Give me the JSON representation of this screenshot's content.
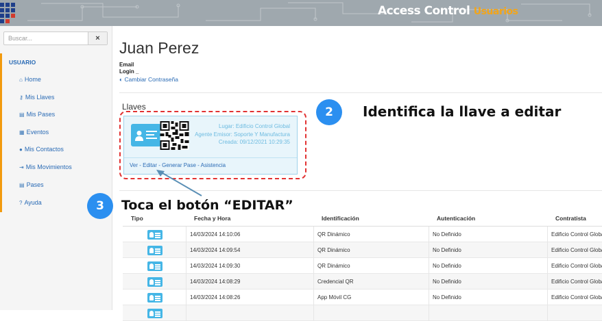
{
  "header": {
    "brand_main": "Access Control",
    "brand_sub": "Usuarios"
  },
  "sidebar": {
    "search_placeholder": "Buscar...",
    "clear_label": "×",
    "section": "USUARIO",
    "items": [
      {
        "icon": "home-icon",
        "glyph": "⌂",
        "label": "Home"
      },
      {
        "icon": "key-icon",
        "glyph": "⚷",
        "label": "Mis Llaves"
      },
      {
        "icon": "id-card-icon",
        "glyph": "▤",
        "label": "Mis Pases"
      },
      {
        "icon": "calendar-icon",
        "glyph": "▦",
        "label": "Eventos"
      },
      {
        "icon": "user-icon",
        "glyph": "●",
        "label": "Mis Contactos"
      },
      {
        "icon": "sign-in-icon",
        "glyph": "⇥",
        "label": "Mis Movimientos"
      },
      {
        "icon": "pass-icon",
        "glyph": "▤",
        "label": "Pases"
      },
      {
        "icon": "question-icon",
        "glyph": "?",
        "label": "Ayuda"
      }
    ]
  },
  "user": {
    "name": "Juan Perez",
    "email_label": "Email",
    "login_label": "Login _",
    "change_password": "Cambiar Contraseña",
    "change_password_icon": "shield-icon"
  },
  "keys": {
    "title": "Llaves",
    "card": {
      "lugar": "Lugar: Edificio Control Global",
      "agente": "Agente Emisor: Soporte Y Manufactura",
      "creada": "Creada: 09/12/2021 10:29:35",
      "actions": {
        "ver": "Ver",
        "editar": "Editar",
        "generar": "Generar Pase",
        "asistencia": "Asistencia",
        "sep": " - "
      }
    }
  },
  "table": {
    "headers": [
      "Tipo",
      "Fecha y Hora",
      "Identificación",
      "Autenticación",
      "Contratista"
    ],
    "rows": [
      {
        "fecha": "14/03/2024 14:10:06",
        "ident": "QR Dinámico",
        "auth": "No Definido",
        "contratista": "Edificio Control Global"
      },
      {
        "fecha": "14/03/2024 14:09:54",
        "ident": "QR Dinámico",
        "auth": "No Definido",
        "contratista": "Edificio Control Global"
      },
      {
        "fecha": "14/03/2024 14:09:30",
        "ident": "QR Dinámico",
        "auth": "No Definido",
        "contratista": "Edificio Control Global"
      },
      {
        "fecha": "14/03/2024 14:08:29",
        "ident": "Credencial QR",
        "auth": "No Definido",
        "contratista": "Edificio Control Global"
      },
      {
        "fecha": "14/03/2024 14:08:26",
        "ident": "App Móvil CG",
        "auth": "No Definido",
        "contratista": "Edificio Control Global"
      },
      {
        "fecha": "",
        "ident": "",
        "auth": "",
        "contratista": ""
      }
    ]
  },
  "callouts": [
    {
      "number": "2",
      "text": "Identifica la llave a editar"
    },
    {
      "number": "3",
      "text": "Toca el botón “EDITAR”"
    }
  ],
  "colors": {
    "accent": "#2a6bb5",
    "callout": "#2b8ff0",
    "sidebar_border": "#f29a0e",
    "dash": "#e23232",
    "card_icon": "#45b6e6"
  }
}
